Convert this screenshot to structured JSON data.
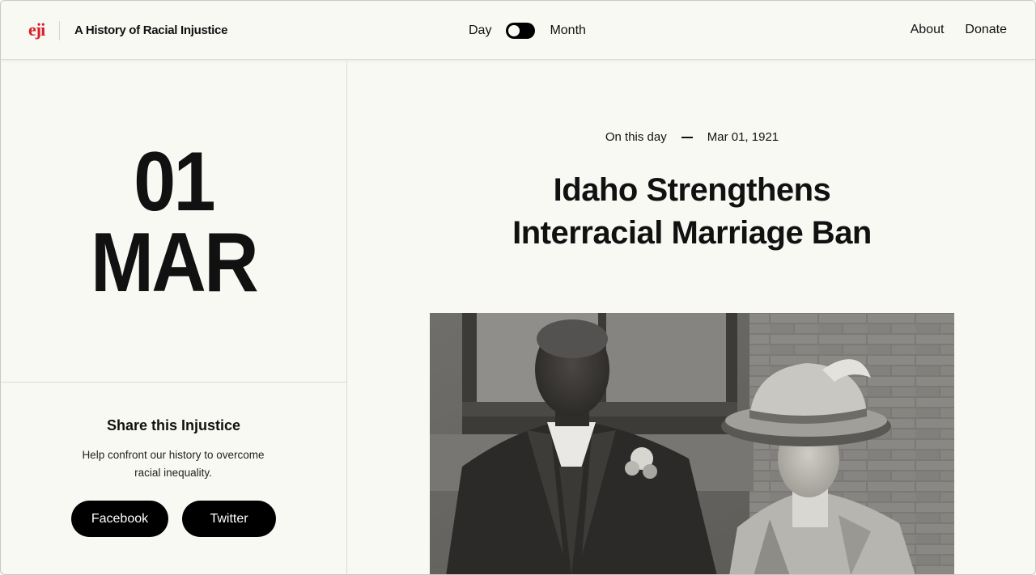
{
  "header": {
    "logo_text": "eji",
    "site_title": "A History of Racial Injustice",
    "toggle": {
      "left_label": "Day",
      "right_label": "Month",
      "state": "day"
    },
    "nav": [
      "About",
      "Donate"
    ]
  },
  "date": {
    "day": "01",
    "month": "MAR"
  },
  "share": {
    "title": "Share this Injustice",
    "text": "Help confront our history to overcome racial inequality.",
    "buttons": [
      "Facebook",
      "Twitter"
    ]
  },
  "article": {
    "kicker_label": "On this day",
    "kicker_date": "Mar 01, 1921",
    "headline_line1": "Idaho Strengthens",
    "headline_line2": "Interracial Marriage Ban",
    "photo_icon": "historical-couple-photo"
  },
  "colors": {
    "brand_red": "#d61f26",
    "background": "#f9f9f4",
    "button_bg": "#000000"
  }
}
